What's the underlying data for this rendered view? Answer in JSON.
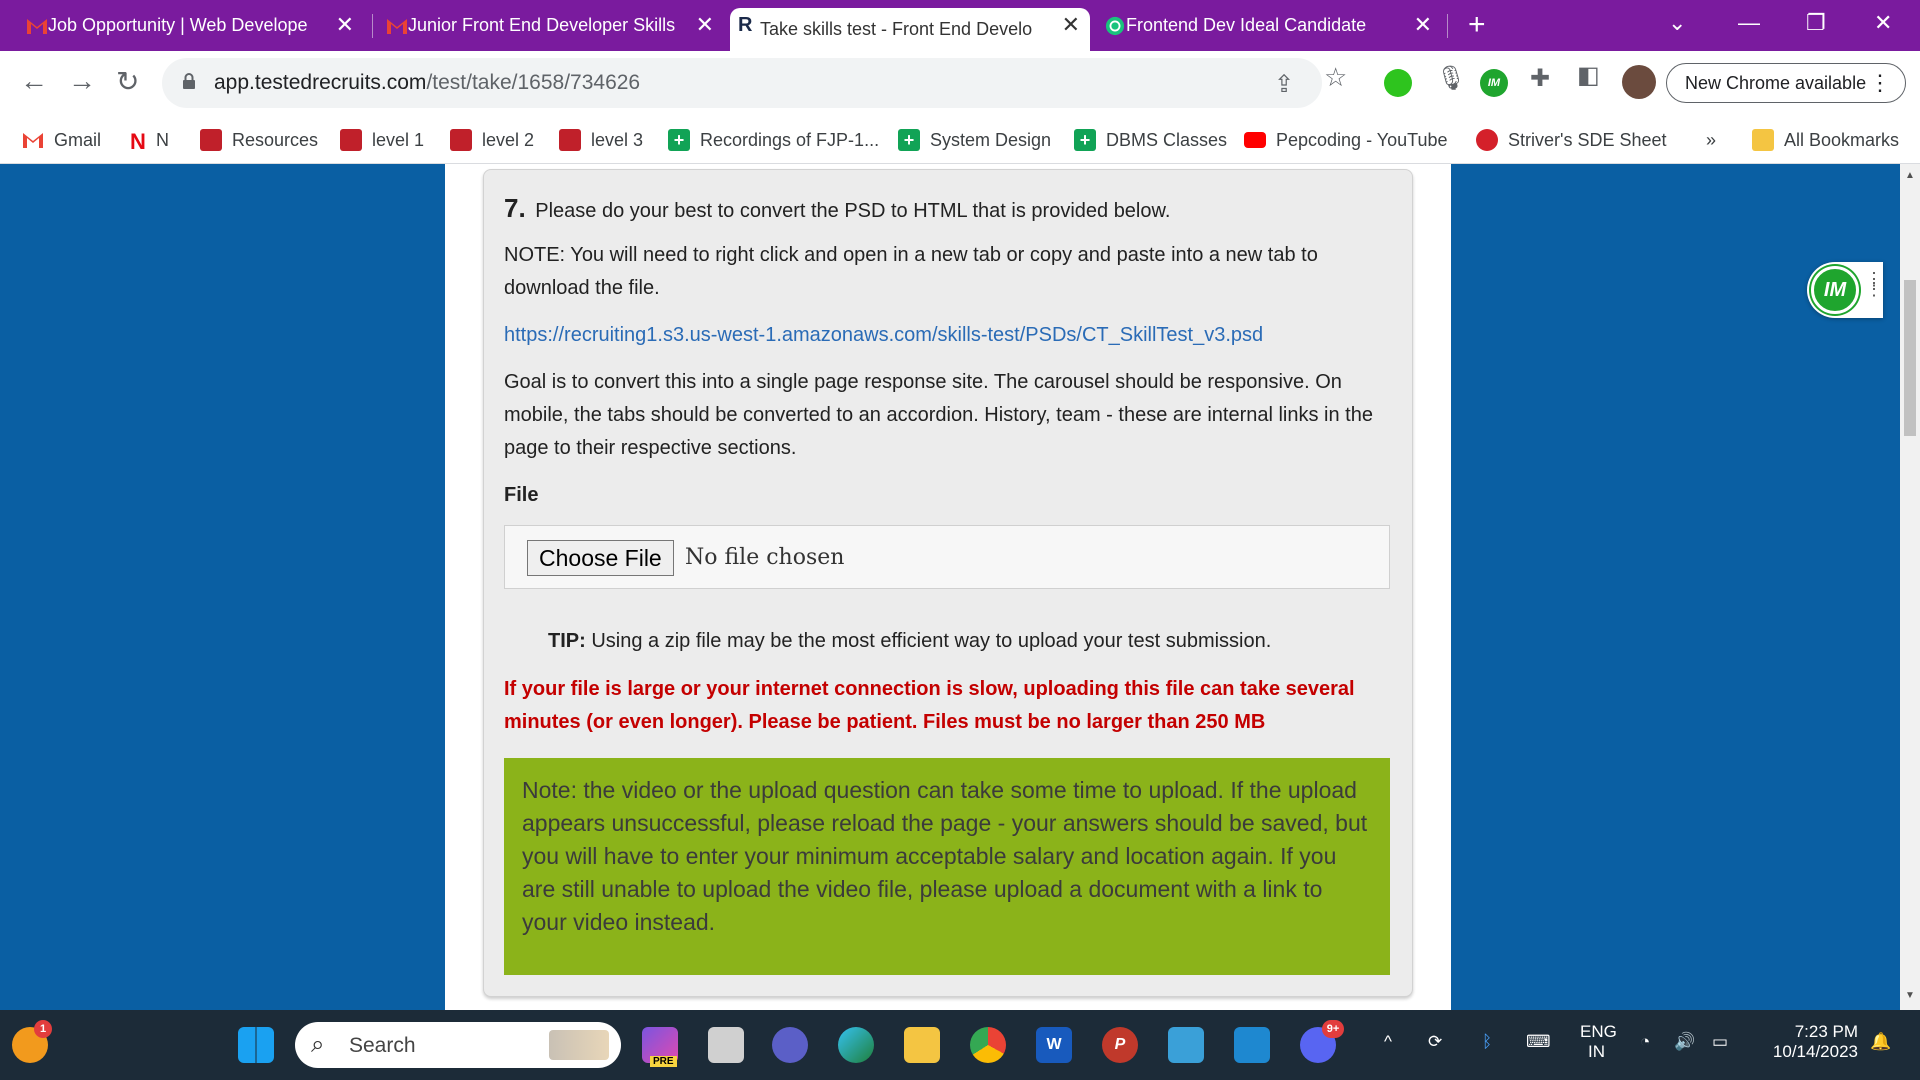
{
  "browser": {
    "tabs": [
      {
        "title": "Job Opportunity | Web Develope",
        "favicon": "gmail-icon"
      },
      {
        "title": "Junior Front End Developer Skills",
        "favicon": "gmail-icon"
      },
      {
        "title": "Take skills test - Front End Develo",
        "favicon": "testedrecruits-icon",
        "active": true
      },
      {
        "title": "Frontend Dev Ideal Candidate",
        "favicon": "chatgpt-icon"
      }
    ],
    "url_host": "app.testedrecruits.com",
    "url_path": "/test/take/1658/734626",
    "new_chrome_label": "New Chrome available",
    "bookmarks": [
      {
        "label": "Gmail"
      },
      {
        "label": "N"
      },
      {
        "label": "Resources"
      },
      {
        "label": "level 1"
      },
      {
        "label": "level 2"
      },
      {
        "label": "level 3"
      },
      {
        "label": "Recordings of FJP-1..."
      },
      {
        "label": "System Design"
      },
      {
        "label": "DBMS Classes"
      },
      {
        "label": "Pepcoding - YouTube"
      },
      {
        "label": "Striver's SDE Sheet"
      },
      {
        "label": "All Bookmarks"
      }
    ],
    "more_bookmarks": "»"
  },
  "question": {
    "number": "7.",
    "prompt": "Please do your best to convert the PSD to HTML that is provided below.",
    "note": "NOTE: You will need to right click and open in a new tab or copy and paste into a new tab to download the file.",
    "link": "https://recruiting1.s3.us-west-1.amazonaws.com/skills-test/PSDs/CT_SkillTest_v3.psd",
    "goal": "Goal is to convert this into a single page response site. The carousel should be responsive. On mobile, the tabs should be converted to an accordion. History, team - these are internal links in the page to their respective sections.",
    "file_label": "File",
    "choose_file_label": "Choose File",
    "no_file_text": "No file chosen",
    "tip_label": "TIP:",
    "tip_text": "Using a zip file may be the most efficient way to upload your test submission.",
    "warning": "If your file is large or your internet connection is slow, uploading this file can take several minutes (or even longer). Please be patient. Files must be no larger than 250 MB",
    "upload_note": "Note: the video or the upload question can take some time to upload. If the upload appears unsuccessful, please reload the page - your answers should be saved, but you will have to enter your minimum acceptable salary and location again. If you are still unable to upload the video file, please upload a document with a link to your video instead."
  },
  "widget": {
    "label": "IM"
  },
  "taskbar": {
    "search_placeholder": "Search",
    "notification_count": "1",
    "discord_badge": "9+",
    "pre_badge": "PRE",
    "language": "ENG",
    "region": "IN",
    "time": "7:23 PM",
    "date": "10/14/2023"
  },
  "colors": {
    "tab_strip": "#7a1b9e",
    "page_background": "#0a5fa3",
    "link": "#2a6bb6",
    "warning": "#c40000",
    "note_box": "#8bb31a"
  }
}
